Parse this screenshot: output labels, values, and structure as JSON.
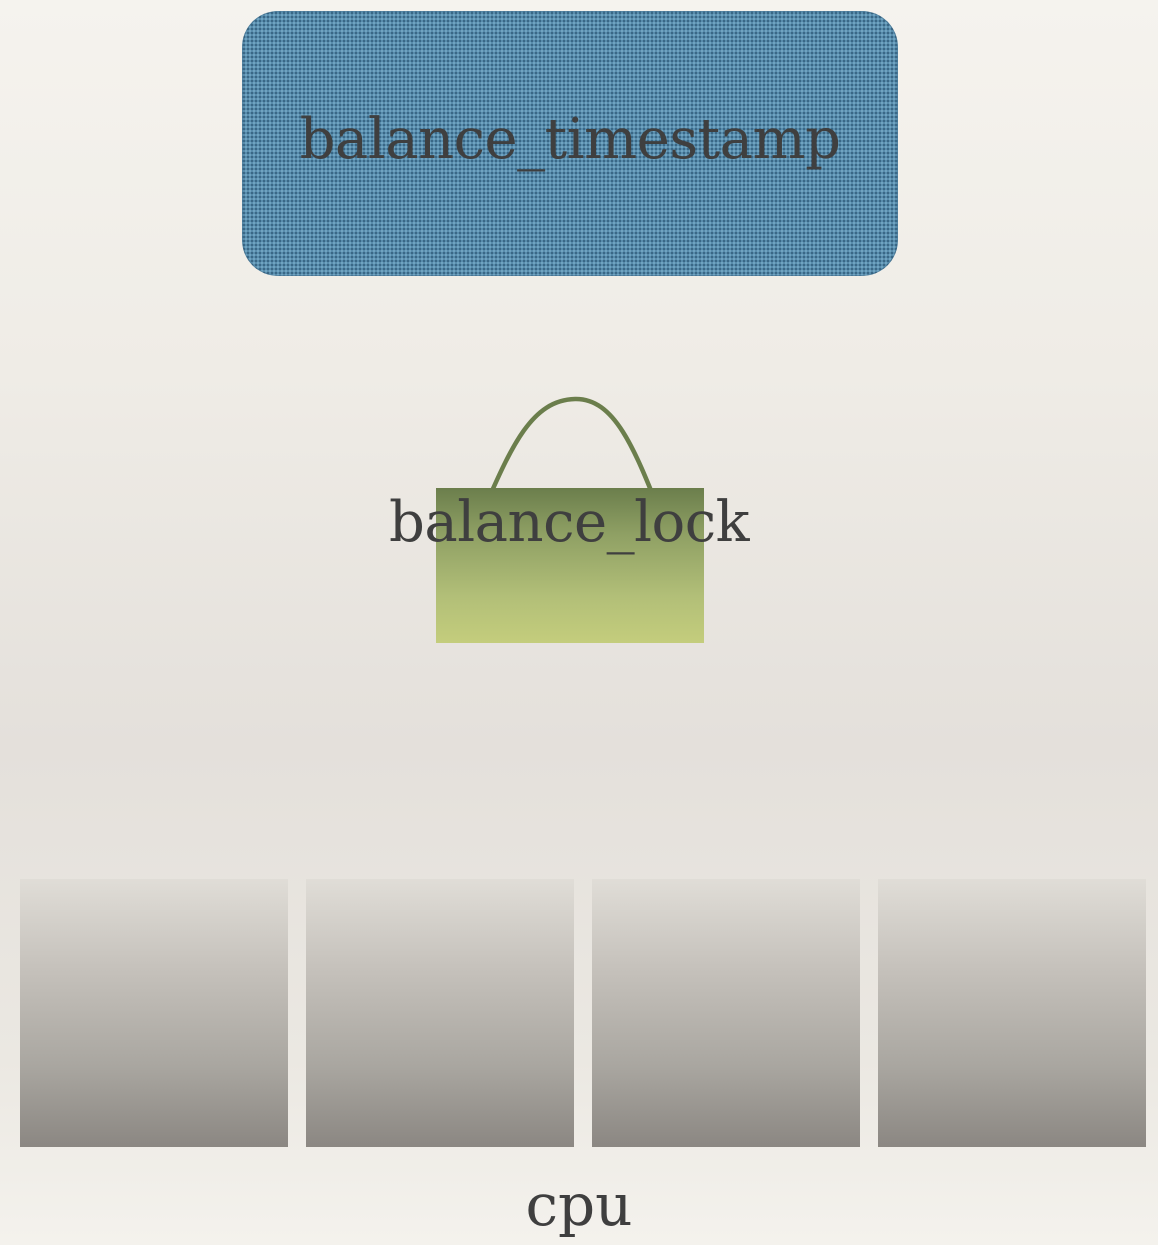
{
  "nodes": {
    "timestamp": {
      "label": "balance_timestamp",
      "color": "#5b90b0"
    },
    "lock": {
      "label": "balance_lock",
      "color": "#a6b46e",
      "shackle_color": "#6b7e4c"
    },
    "cpu": {
      "label": "cpu",
      "cell_count": 4,
      "color": "#a9a6a0"
    }
  }
}
